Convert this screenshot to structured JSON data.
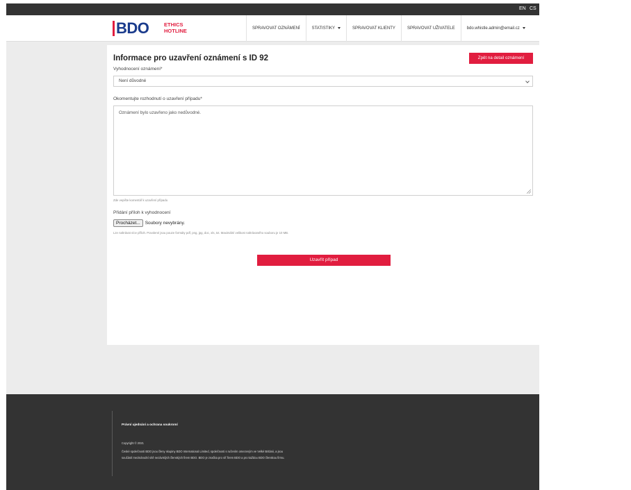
{
  "languages": [
    "EN",
    "CS"
  ],
  "brand": {
    "logo_text": "BDO",
    "tagline_line1": "ETHICS",
    "tagline_line2": "HOTLINE",
    "accent": "#e11d3f",
    "logo_color": "#1a3b8c"
  },
  "nav": {
    "items": [
      {
        "label": "SPRAVOVAT OZNÁMENÍ"
      },
      {
        "label": "STATISTIKY"
      },
      {
        "label": "SPRAVOVAT KLIENTY"
      },
      {
        "label": "SPRAVOVAT UŽIVATELE"
      },
      {
        "label": "bdo.whistle.admin@email.cz"
      }
    ]
  },
  "page": {
    "title": "Informace pro uzavření oznámení s ID 92",
    "back_button": "Zpět na detail oznámení",
    "evaluation_label": "Vyhodnocení oznámení*",
    "evaluation_value": "Není důvodné",
    "comment_label": "Okomentujte rozhodnutí o uzavření případu*",
    "comment_value": "Oznámení bylo uzavřeno jako nedůvodné.",
    "comment_hint": "Zde vepište komentář k uzavření případu",
    "attachments_label": "Přidání příloh k vyhodnocení",
    "browse_button": "Procházet...",
    "file_status": "Soubory nevybrány.",
    "attachments_hint": "Lze nahrávat více příloh. Povolené jsou pouze formáty pdf, png, jpg, doc, xls, txt. Maximální velikost nahrávaného souboru je 10 MB.",
    "submit_button": "Uzavřít případ"
  },
  "footer": {
    "privacy_link": "Právní ujednání a ochrana soukromí",
    "copyright": "Copyright © 2021",
    "text": "České společnosti BDO jsou členy skupiny BDO International Limited, společnosti s ručením omezeným ve Velké Británii, a jsou součástí mezinárodní sítě nezávislých členských firem BDO. BDO je značka pro síť firem BDO a pro každou BDO členskou firmu."
  }
}
